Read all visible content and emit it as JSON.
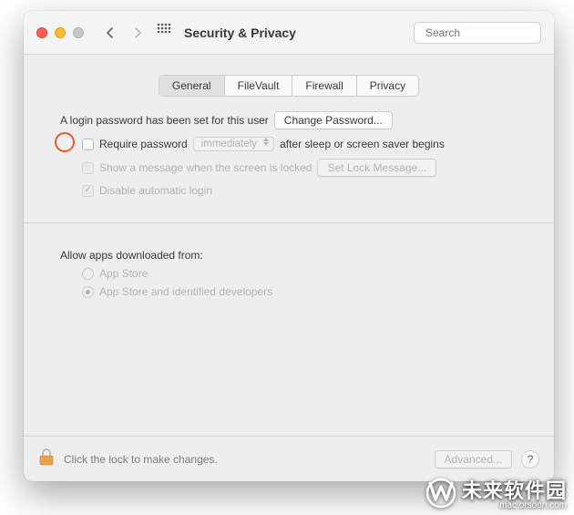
{
  "header": {
    "title": "Security & Privacy",
    "search_placeholder": "Search"
  },
  "tabs": [
    {
      "label": "General",
      "active": true
    },
    {
      "label": "FileVault",
      "active": false
    },
    {
      "label": "Firewall",
      "active": false
    },
    {
      "label": "Privacy",
      "active": false
    }
  ],
  "general": {
    "login_password_text": "A login password has been set for this user",
    "change_password_btn": "Change Password...",
    "require_password_label": "Require password",
    "require_password_delay": "immediately",
    "require_password_suffix": "after sleep or screen saver begins",
    "show_message_label": "Show a message when the screen is locked",
    "set_lock_message_btn": "Set Lock Message...",
    "disable_auto_login_label": "Disable automatic login"
  },
  "allow_apps": {
    "title": "Allow apps downloaded from:",
    "options": [
      "App Store",
      "App Store and identified developers"
    ],
    "selected_index": 1
  },
  "footer": {
    "lock_text": "Click the lock to make changes.",
    "advanced_btn": "Advanced...",
    "help": "?"
  },
  "watermark": {
    "main": "未来软件园",
    "sub": "mac.orsoon.com"
  }
}
